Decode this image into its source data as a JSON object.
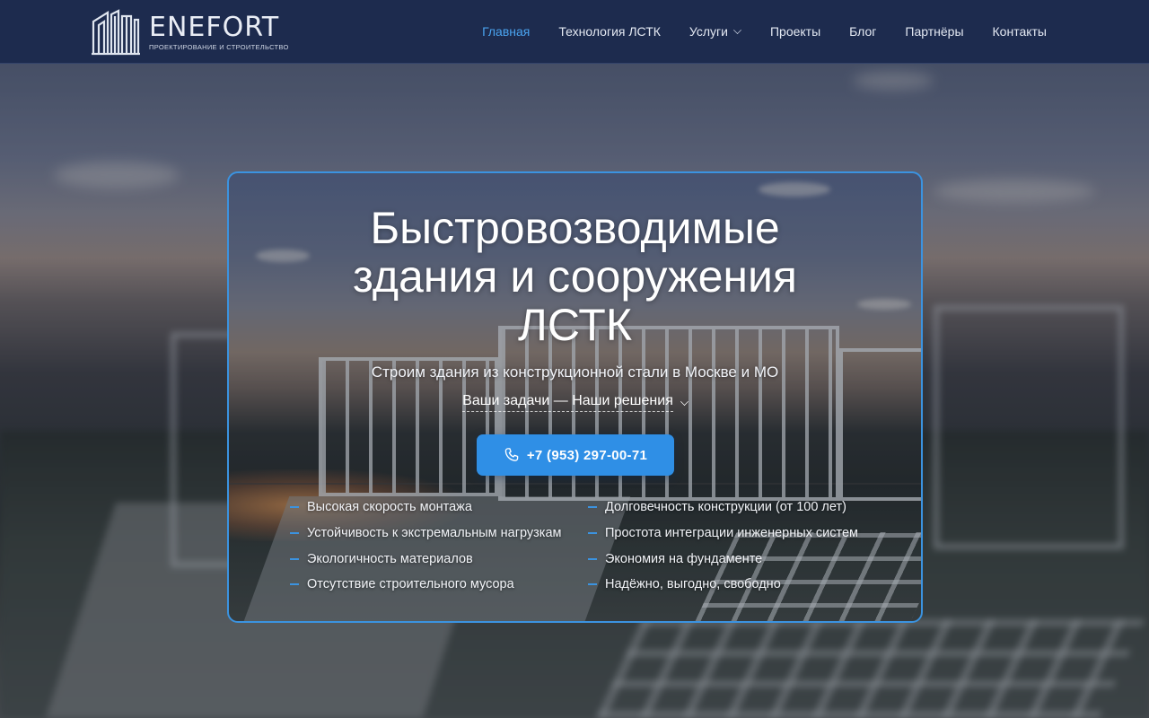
{
  "header": {
    "logo": {
      "name": "ENEFORT",
      "tagline": "ПРОЕКТИРОВАНИЕ И СТРОИТЕЛЬСТВО",
      "icon": "building-logo-icon"
    },
    "nav": [
      {
        "label": "Главная",
        "active": true
      },
      {
        "label": "Технология ЛСТК",
        "active": false
      },
      {
        "label": "Услуги",
        "active": false,
        "has_dropdown": true
      },
      {
        "label": "Проекты",
        "active": false
      },
      {
        "label": "Блог",
        "active": false
      },
      {
        "label": "Партнёры",
        "active": false
      },
      {
        "label": "Контакты",
        "active": false
      }
    ]
  },
  "hero": {
    "title_lines": [
      "Быстровозводимые",
      "здания и сооружения",
      "ЛСТК"
    ],
    "subtitle": "Строим здания из конструкционной стали в Москве и МО",
    "tasks_link": "Ваши задачи — Наши решения",
    "phone_button": "+7 (953) 297-00-71",
    "phone_icon": "phone-icon",
    "features": [
      "Высокая скорость монтажа",
      "Долговечность конструкции (от 100 лет)",
      "Устойчивость к экстремальным нагрузкам",
      "Простота интеграции инженерных систем",
      "Экологичность материалов",
      "Экономия на фундаменте",
      "Отсутствие строительного мусора",
      "Надёжно, выгодно, свободно"
    ]
  },
  "colors": {
    "header_bg": "#1d2b4e",
    "accent": "#2f8fe6",
    "active_nav": "#4aa3ef",
    "card_border": "#3b93e0"
  }
}
